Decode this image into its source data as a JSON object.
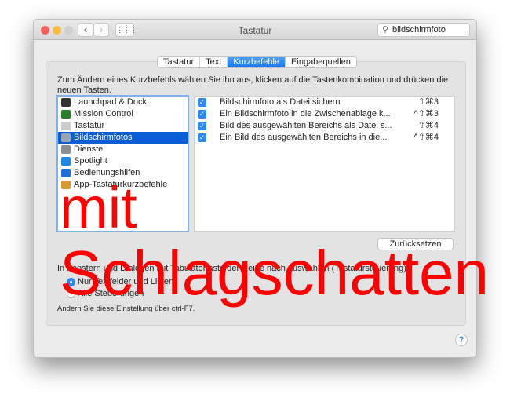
{
  "window": {
    "title": "Tastatur",
    "search_value": "bildschirmfoto",
    "back": "‹",
    "forward": "›",
    "grid": "⋮⋮⋮"
  },
  "tabs": [
    {
      "label": "Tastatur"
    },
    {
      "label": "Text"
    },
    {
      "label": "Kurzbefehle",
      "selected": true
    },
    {
      "label": "Eingabequellen"
    }
  ],
  "description": "Zum Ändern eines Kurzbefehls wählen Sie ihn aus, klicken auf die Tastenkombination und drücken die neuen Tasten.",
  "categories": [
    {
      "label": "Launchpad & Dock",
      "icon": "launchpad-icon",
      "color": "#333333"
    },
    {
      "label": "Mission Control",
      "icon": "mission-control-icon",
      "color": "#2a7d2a"
    },
    {
      "label": "Tastatur",
      "icon": "keyboard-icon",
      "color": "#cccccc"
    },
    {
      "label": "Bildschirmfotos",
      "icon": "screenshot-icon",
      "color": "#9aa4b0",
      "selected": true
    },
    {
      "label": "Dienste",
      "icon": "gear-icon",
      "color": "#8a8f96"
    },
    {
      "label": "Spotlight",
      "icon": "spotlight-icon",
      "color": "#1e88e5"
    },
    {
      "label": "Bedienungshilfen",
      "icon": "accessibility-icon",
      "color": "#1e6fd9"
    },
    {
      "label": "App-Tastaturkurzbefehle",
      "icon": "app-shortcuts-icon",
      "color": "#d99a2b"
    }
  ],
  "shortcuts": [
    {
      "checked": true,
      "label": "Bildschirmfoto als Datei sichern",
      "keys": "⇧⌘3"
    },
    {
      "checked": true,
      "label": "Ein Bildschirmfoto in die Zwischenablage k...",
      "keys": "^⇧⌘3"
    },
    {
      "checked": true,
      "label": "Bild des ausgewählten Bereichs als Datei s...",
      "keys": "⇧⌘4"
    },
    {
      "checked": true,
      "label": "Ein Bild des ausgewählten Bereichs in die...",
      "keys": "^⇧⌘4"
    }
  ],
  "reset_label": "Zurücksetzen",
  "keyboard_control": {
    "label": "In Fenstern und Dialogen mit Tabulatortaste der Reihe nach auswählen (Tastatursteuerung):",
    "options": [
      {
        "label": "Nur Textfelder und Listen",
        "selected": true
      },
      {
        "label": "Alle Steuerungen",
        "selected": false
      }
    ],
    "hint": "Ändern Sie diese Einstellung über ctrl-F7."
  },
  "help": "?",
  "overlay": {
    "line1": "mit",
    "line2": "Schlagschatten",
    "color": "#ff0000"
  }
}
